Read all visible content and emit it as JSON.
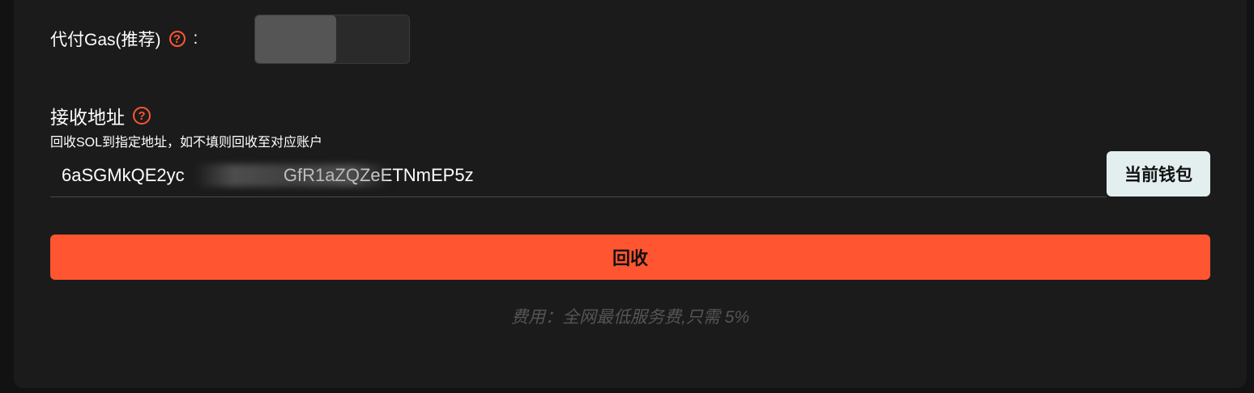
{
  "gas": {
    "label": "代付Gas(推荐)",
    "help_glyph": "?",
    "colon": ":",
    "toggle_on": false
  },
  "address": {
    "title": "接收地址",
    "help_glyph": "?",
    "description": "回收SOL到指定地址，如不填则回收至对应账户",
    "value": "6aSGMkQE2yc                    GfR1aZQZeETNmEP5z",
    "current_wallet_label": "当前钱包"
  },
  "recycle": {
    "label": "回收"
  },
  "fee_note": "费用：全网最低服务费,只需 5%",
  "colors": {
    "accent": "#ff5530",
    "panel": "#1b1b1b",
    "wallet_button": "#e3eeee"
  }
}
